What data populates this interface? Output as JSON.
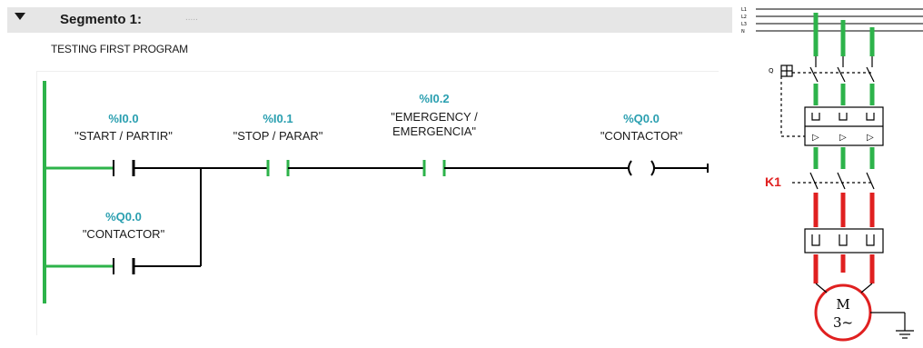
{
  "segment": {
    "title": "Segmento 1:",
    "comment_placeholder": ".....",
    "description": "TESTING FIRST PROGRAM"
  },
  "ladder": {
    "rung1": {
      "contacts": [
        {
          "address": "%I0.0",
          "tag": "\"START / PARTIR\"",
          "type": "NO-contact"
        },
        {
          "address": "%I0.1",
          "tag": "\"STOP  / PARAR\"",
          "type": "NO-contact"
        },
        {
          "address": "%I0.2",
          "tag_line1": "\"EMERGENCY /",
          "tag_line2": "EMERGENCIA\"",
          "type": "NO-contact"
        }
      ],
      "coil": {
        "address": "%Q0.0",
        "tag": "\"CONTACTOR\"",
        "type": "coil"
      }
    },
    "branch": {
      "contact": {
        "address": "%Q0.0",
        "tag": "\"CONTACTOR\"",
        "type": "NO-contact"
      }
    }
  },
  "diagram": {
    "contactor_label": "K1",
    "motor_label_line1": "M",
    "motor_label_line2": "3~",
    "colors": {
      "supply": "#2db34a",
      "load": "#e02020",
      "label": "#e02020"
    }
  },
  "colors": {
    "rail": "#2db34a",
    "energized": "#2db34a",
    "wire": "#000000",
    "address": "#2a9fb0",
    "header_bg": "#e6e6e6"
  }
}
